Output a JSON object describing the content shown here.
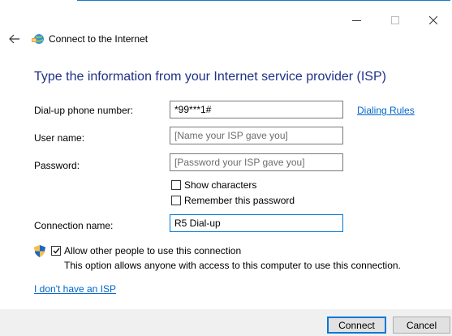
{
  "window": {
    "title": "Connect to the Internet",
    "controls": {
      "minimize": "—",
      "maximize": "□",
      "close": "✕"
    }
  },
  "nav": {
    "back_icon": "back-arrow-icon",
    "app_icon": "network-globe-icon"
  },
  "heading": "Type the information from your Internet service provider (ISP)",
  "form": {
    "phone_label": "Dial-up phone number:",
    "phone_value": "*99***1#",
    "dialing_rules_link": "Dialing Rules",
    "username_label": "User name:",
    "username_placeholder": "[Name your ISP gave you]",
    "password_label": "Password:",
    "password_placeholder": "[Password your ISP gave you]",
    "show_characters_label": "Show characters",
    "show_characters_checked": false,
    "remember_password_label": "Remember this password",
    "remember_password_checked": false,
    "connection_name_label": "Connection name:",
    "connection_name_value": "R5 Dial-up",
    "allow_others_label": "Allow other people to use this connection",
    "allow_others_checked": true,
    "allow_others_description": "This option allows anyone with access to this computer to use this connection.",
    "no_isp_link": "I don't have an ISP"
  },
  "buttons": {
    "connect": "Connect",
    "cancel": "Cancel"
  },
  "colors": {
    "heading": "#1e3287",
    "link": "#0066cc",
    "accent": "#0078d7",
    "footer": "#f0f0f0"
  }
}
